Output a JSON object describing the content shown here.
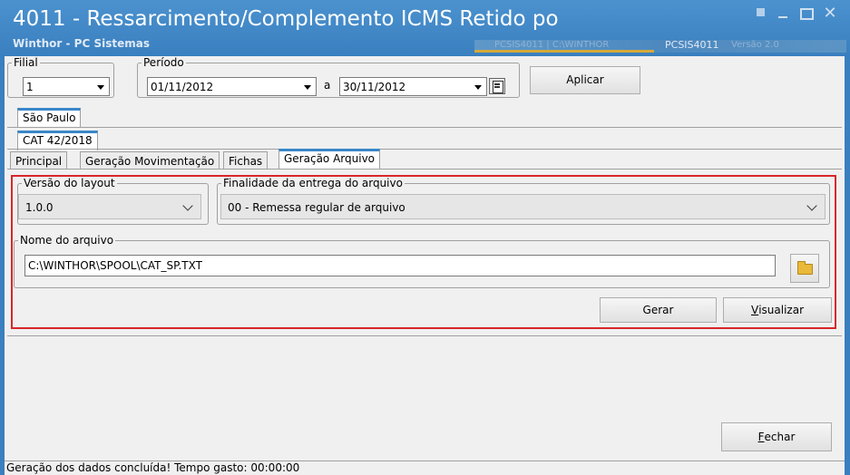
{
  "window": {
    "title": "4011 - Ressarcimento/Complemento ICMS Retido po",
    "subtitle": "Winthor - PC Sistemas",
    "routine_code": "PCSIS4011",
    "blurred_left": "PCSIS4011  |  C:\\WINTHOR",
    "blurred_right": "Versão  2.0"
  },
  "filters": {
    "filial_label": "Filial",
    "filial_value": "1",
    "periodo_label": "Período",
    "date_from": "01/11/2012",
    "separator": "a",
    "date_to": "30/11/2012",
    "apply_label": "Aplicar"
  },
  "tabs": {
    "state": "São Paulo",
    "legislation": "CAT 42/2018",
    "sections": [
      "Principal",
      "Geração Movimentação",
      "Fichas",
      "Geração Arquivo"
    ]
  },
  "geracao_arquivo": {
    "layout_version_label": "Versão do layout",
    "layout_version_value": "1.0.0",
    "purpose_label": "Finalidade da entrega do arquivo",
    "purpose_value": "00 - Remessa regular de arquivo",
    "filename_label": "Nome do arquivo",
    "filename_value": "C:\\WINTHOR\\SPOOL\\CAT_SP.TXT",
    "generate_label": "Gerar",
    "view_label_first": "V",
    "view_label_rest": "isualizar"
  },
  "footer": {
    "close_first": "F",
    "close_rest": "echar",
    "status": "Geração dos dados concluída! Tempo gasto: 00:00:00"
  },
  "colors": {
    "titlebar": "#3a7fbf",
    "highlight_border": "#d9262c",
    "active_tab_accent": "#3a86c8"
  },
  "icons": [
    "restore-icon",
    "minimize-icon",
    "maximize-icon",
    "close-icon",
    "calendar-icon",
    "folder-icon",
    "chevron-down-icon"
  ]
}
